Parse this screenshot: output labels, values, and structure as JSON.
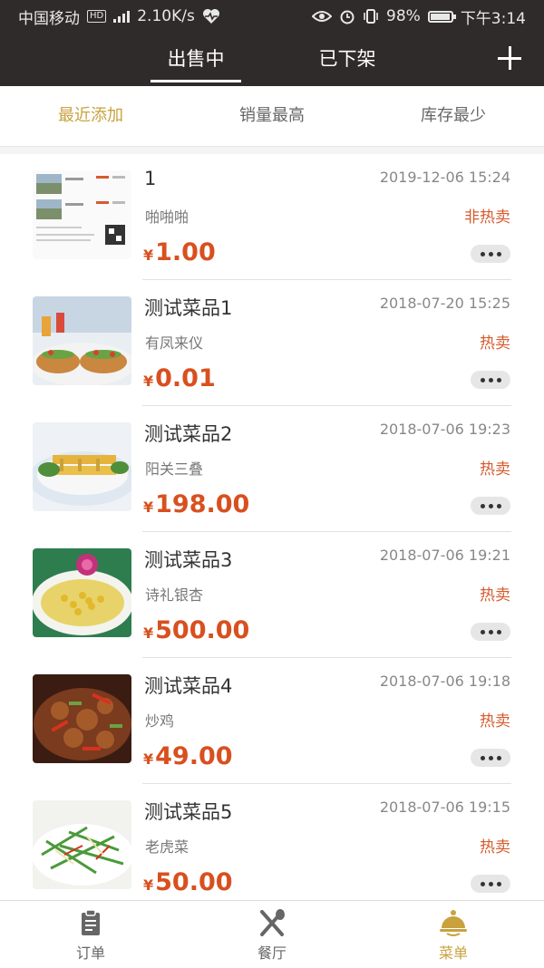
{
  "status_bar": {
    "carrier": "中国移动",
    "hd": "HD",
    "speed": "2.10K/s",
    "battery": "98%",
    "time": "下午3:14"
  },
  "header": {
    "tabs": [
      {
        "label": "出售中",
        "active": true
      },
      {
        "label": "已下架",
        "active": false
      }
    ]
  },
  "sort": {
    "options": [
      "最近添加",
      "销量最高",
      "库存最少"
    ],
    "active_index": 0,
    "active_color": "#c9a23e"
  },
  "items": [
    {
      "name": "1",
      "date": "2019-12-06 15:24",
      "desc": "啪啪啪",
      "tag": "非热卖",
      "currency": "¥",
      "price": "1.00"
    },
    {
      "name": "测试菜品1",
      "date": "2018-07-20 15:25",
      "desc": "有凤来仪",
      "tag": "热卖",
      "currency": "¥",
      "price": "0.01"
    },
    {
      "name": "测试菜品2",
      "date": "2018-07-06 19:23",
      "desc": "阳关三叠",
      "tag": "热卖",
      "currency": "¥",
      "price": "198.00"
    },
    {
      "name": "测试菜品3",
      "date": "2018-07-06 19:21",
      "desc": "诗礼银杏",
      "tag": "热卖",
      "currency": "¥",
      "price": "500.00"
    },
    {
      "name": "测试菜品4",
      "date": "2018-07-06 19:18",
      "desc": "炒鸡",
      "tag": "热卖",
      "currency": "¥",
      "price": "49.00"
    },
    {
      "name": "测试菜品5",
      "date": "2018-07-06 19:15",
      "desc": "老虎菜",
      "tag": "热卖",
      "currency": "¥",
      "price": "50.00"
    }
  ],
  "colors": {
    "header_bg": "#2f2b2a",
    "price": "#d8501f",
    "tag": "#d65a2e",
    "accent": "#c9a23e"
  },
  "bottom_nav": {
    "items": [
      {
        "label": "订单",
        "icon": "clipboard-icon",
        "active": false
      },
      {
        "label": "餐厅",
        "icon": "fork-knife-icon",
        "active": false
      },
      {
        "label": "菜单",
        "icon": "cloche-icon",
        "active": true
      }
    ]
  }
}
